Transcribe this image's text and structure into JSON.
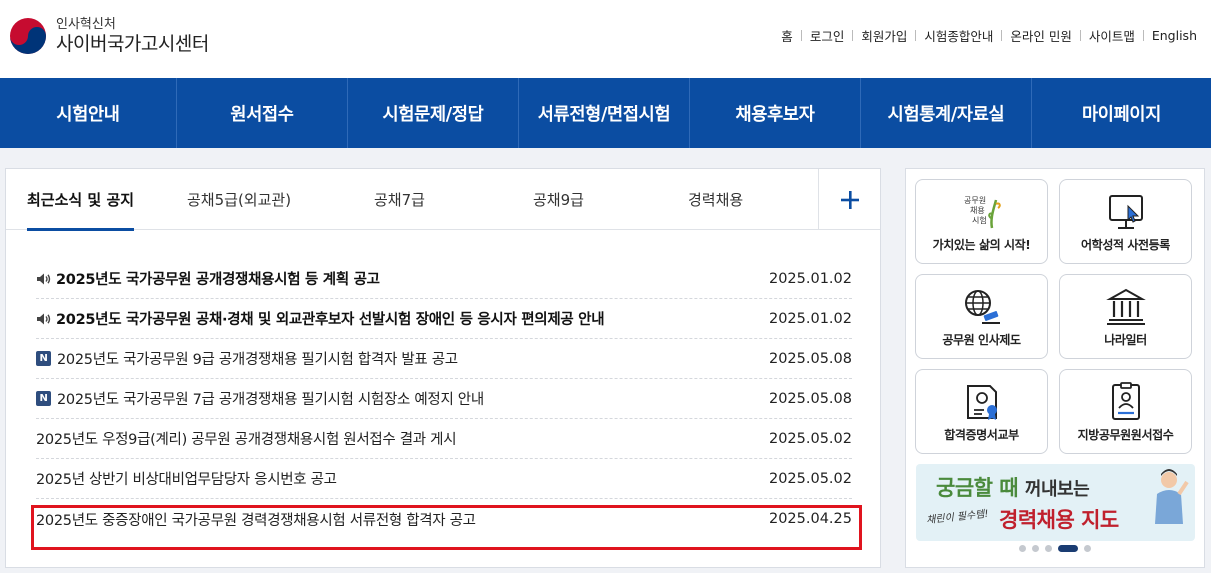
{
  "header": {
    "org": "인사혁신처",
    "site_name": "사이버국가고시센터",
    "util_links": [
      "홈",
      "로그인",
      "회원가입",
      "시험종합안내",
      "온라인 민원",
      "사이트맵",
      "English"
    ]
  },
  "gnb": [
    "시험안내",
    "원서접수",
    "시험문제/정답",
    "서류전형/면접시험",
    "채용후보자",
    "시험통계/자료실",
    "마이페이지"
  ],
  "notice": {
    "tabs": [
      "최근소식 및 공지",
      "공채5급(외교관)",
      "공채7급",
      "공채9급",
      "경력채용"
    ],
    "active_tab": "최근소식 및 공지",
    "items": [
      {
        "title": "2025년도 국가공무원 공개경쟁채용시험 등 계획 공고",
        "date": "2025.01.02",
        "icon": "speaker-icon",
        "bold": true
      },
      {
        "title": "2025년도 국가공무원 공채·경채 및 외교관후보자 선발시험 장애인 등 응시자 편의제공 안내",
        "date": "2025.01.02",
        "icon": "speaker-icon",
        "bold": true
      },
      {
        "title": "2025년도 국가공무원 9급 공개경쟁채용 필기시험 합격자 발표 공고",
        "date": "2025.05.08",
        "icon": "new-badge",
        "badge": "N",
        "bold": false,
        "highlighted": true
      },
      {
        "title": "2025년도 국가공무원 7급 공개경쟁채용 필기시험 시험장소 예정지 안내",
        "date": "2025.05.08",
        "icon": "new-badge",
        "badge": "N",
        "bold": false
      },
      {
        "title": "2025년도 우정9급(계리) 공무원 공개경쟁채용시험 원서접수 결과 게시",
        "date": "2025.05.02",
        "bold": false
      },
      {
        "title": "2025년 상반기 비상대비업무담당자 응시번호 공고",
        "date": "2025.05.02",
        "bold": false
      },
      {
        "title": "2025년도 중증장애인 국가공무원 경력경쟁채용시험 서류전형 합격자 공고",
        "date": "2025.04.25",
        "bold": false
      }
    ]
  },
  "quick_links": [
    {
      "label": "가치있는 삶의 시작!",
      "icon": "civil-service-exam-logo-icon",
      "logo_text": "공무원 채용 시험"
    },
    {
      "label": "어학성적 사전등록",
      "icon": "monitor-cursor-icon"
    },
    {
      "label": "공무원 인사제도",
      "icon": "globe-gavel-icon"
    },
    {
      "label": "나라일터",
      "icon": "government-building-icon"
    },
    {
      "label": "합격증명서교부",
      "icon": "certificate-icon"
    },
    {
      "label": "지방공무원원서접수",
      "icon": "document-person-icon"
    }
  ],
  "banner": {
    "line1_a": "궁금할 때",
    "line1_b": "꺼내보는",
    "sub": "채린이 필수템!",
    "line2": "경력채용 지도"
  },
  "carousel": {
    "count": 5,
    "active": 4
  },
  "colors": {
    "primary": "#0b4da2",
    "highlight": "#e0141e",
    "badge": "#2e4d7e"
  }
}
